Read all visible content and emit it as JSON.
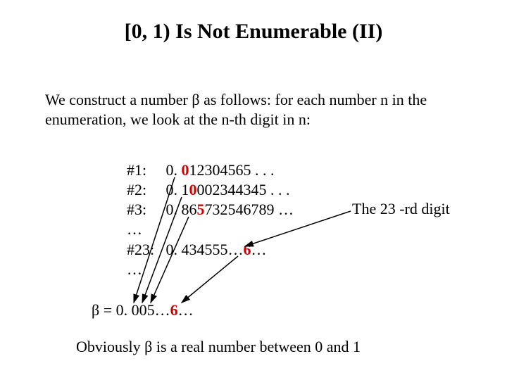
{
  "title": "[0, 1) Is Not Enumerable (II)",
  "intro": "We construct a number β as follows: for each number n in the enumeration, we look at the n-th digit in n:",
  "rows": {
    "r1": {
      "label": "#1:",
      "pre": "0. ",
      "hl": "0",
      "post": "12304565 . . ."
    },
    "r2": {
      "label": "#2:",
      "pre": "0. 1",
      "hl": "0",
      "post": "002344345 . . ."
    },
    "r3": {
      "label": "#3:",
      "pre": "0. 86",
      "hl": "5",
      "post": "732546789 …"
    },
    "dots1": "…",
    "r23": {
      "label": "#23:",
      "pre": "0. 434555…",
      "hl": "6",
      "post": "…"
    },
    "dots2": "…"
  },
  "annotation": "The 23 -rd digit",
  "beta": {
    "pre": "β = 0. 005…",
    "hl": "6",
    "post": "…"
  },
  "conclusion": "Obviously β is a real number between 0 and 1"
}
